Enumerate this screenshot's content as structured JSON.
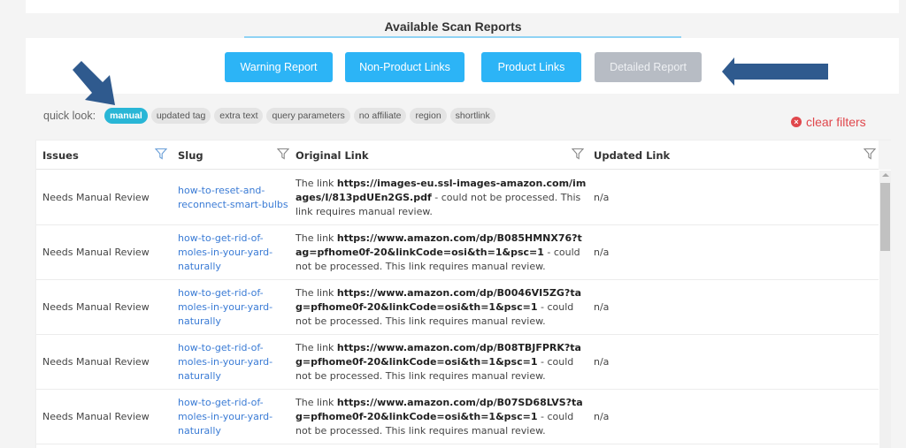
{
  "section": {
    "title": "Available Scan Reports"
  },
  "report_buttons": [
    {
      "label": "Warning Report",
      "state": "enabled"
    },
    {
      "label": "Non-Product Links",
      "state": "enabled"
    },
    {
      "label": "Product Links",
      "state": "enabled"
    },
    {
      "label": "Detailed Report",
      "state": "disabled"
    }
  ],
  "quick_look": {
    "label": "quick look:",
    "chips": [
      {
        "label": "manual",
        "active": true
      },
      {
        "label": "updated tag",
        "active": false
      },
      {
        "label": "extra text",
        "active": false
      },
      {
        "label": "query parameters",
        "active": false
      },
      {
        "label": "no affiliate",
        "active": false
      },
      {
        "label": "region",
        "active": false
      },
      {
        "label": "shortlink",
        "active": false
      }
    ]
  },
  "clear_filters": {
    "label": "clear filters",
    "icon": "close-circle-icon"
  },
  "colors": {
    "button_blue": "#2cb4f6",
    "button_disabled": "#b7bcc4",
    "chip_active": "#29b6d6",
    "clear_red": "#e0474c",
    "slug_link": "#3a7bd5",
    "arrow": "#2f5a8e"
  },
  "table": {
    "columns": [
      "Issues",
      "Slug",
      "Original Link",
      "Updated Link"
    ],
    "rows": [
      {
        "issue": "Needs Manual Review",
        "slug": "how-to-reset-and-reconnect-smart-bulbs",
        "orig_prefix": "The link ",
        "orig_url": "https://images-eu.ssl-images-amazon.com/images/I/813pdUEn2GS.pdf",
        "orig_suffix": " - could not be processed. This link requires manual review.",
        "updated": "n/a"
      },
      {
        "issue": "Needs Manual Review",
        "slug": "how-to-get-rid-of-moles-in-your-yard-naturally",
        "orig_prefix": "The link ",
        "orig_url": "https://www.amazon.com/dp/B085HMNX76?tag=pfhome0f-20&linkCode=osi&th=1&psc=1",
        "orig_suffix": " - could not be processed. This link requires manual review.",
        "updated": "n/a"
      },
      {
        "issue": "Needs Manual Review",
        "slug": "how-to-get-rid-of-moles-in-your-yard-naturally",
        "orig_prefix": "The link ",
        "orig_url": "https://www.amazon.com/dp/B0046VI5ZG?tag=pfhome0f-20&linkCode=osi&th=1&psc=1",
        "orig_suffix": " - could not be processed. This link requires manual review.",
        "updated": "n/a"
      },
      {
        "issue": "Needs Manual Review",
        "slug": "how-to-get-rid-of-moles-in-your-yard-naturally",
        "orig_prefix": "The link ",
        "orig_url": "https://www.amazon.com/dp/B08TBJFPRK?tag=pfhome0f-20&linkCode=osi&th=1&psc=1",
        "orig_suffix": " - could not be processed. This link requires manual review.",
        "updated": "n/a"
      },
      {
        "issue": "Needs Manual Review",
        "slug": "how-to-get-rid-of-moles-in-your-yard-naturally",
        "orig_prefix": "The link ",
        "orig_url": "https://www.amazon.com/dp/B07SD68LVS?tag=pfhome0f-20&linkCode=osi&th=1&psc=1",
        "orig_suffix": " - could not be processed. This link requires manual review.",
        "updated": "n/a"
      }
    ]
  }
}
